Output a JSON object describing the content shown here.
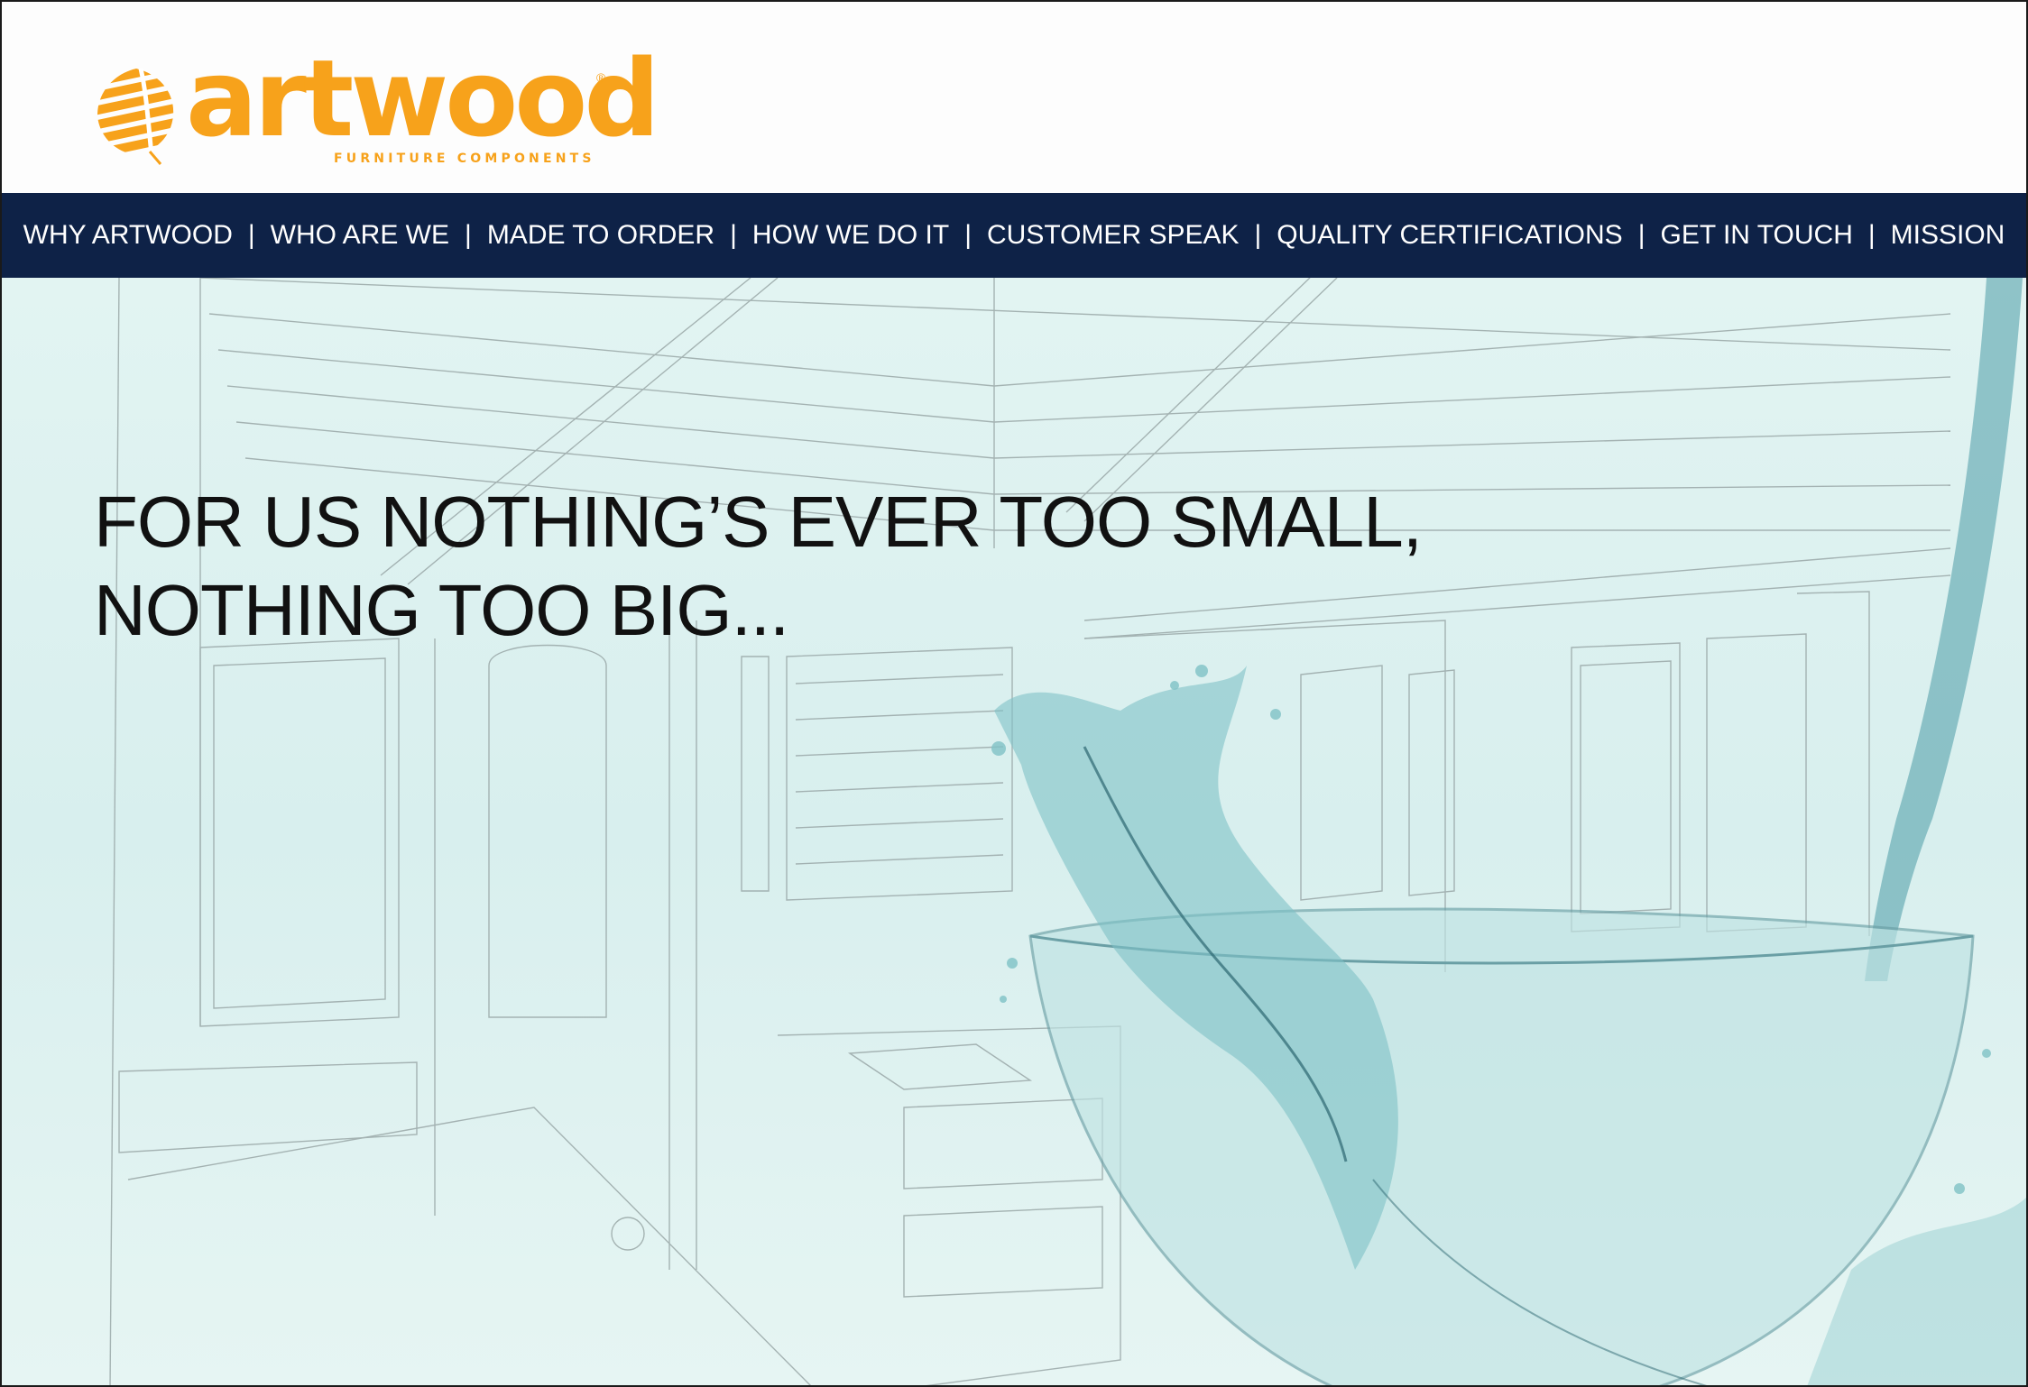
{
  "brand": {
    "name": "artwood",
    "registered_mark": "®",
    "tagline": "FURNITURE COMPONENTS",
    "color": "#f7a21b"
  },
  "nav": {
    "background": "#0e2247",
    "separator": "|",
    "items": [
      {
        "label": "WHY ARTWOOD"
      },
      {
        "label": "WHO ARE WE"
      },
      {
        "label": "MADE TO ORDER"
      },
      {
        "label": "HOW WE DO IT"
      },
      {
        "label": "CUSTOMER SPEAK"
      },
      {
        "label": "QUALITY CERTIFICATIONS"
      },
      {
        "label": "GET IN TOUCH"
      },
      {
        "label": "MISSION"
      }
    ]
  },
  "hero": {
    "headline_line1": "FOR US NOTHING’S EVER TOO SMALL,",
    "headline_line2": "NOTHING TOO BIG..."
  }
}
